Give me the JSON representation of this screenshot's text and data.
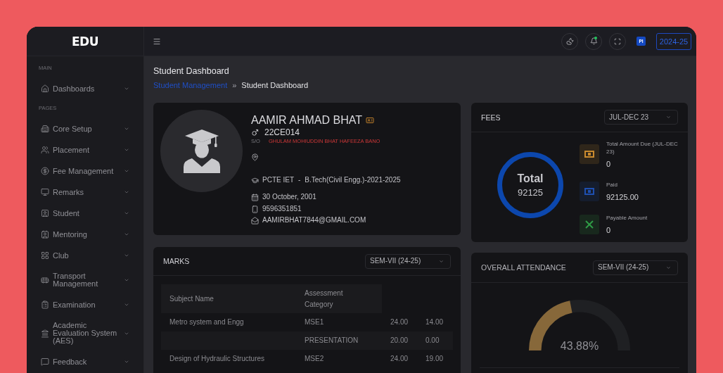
{
  "sidebar": {
    "logo": "EDU",
    "sections": [
      {
        "label": "MAIN",
        "items": [
          {
            "label": "Dashboards",
            "expanded": false
          }
        ]
      },
      {
        "label": "PAGES",
        "items": [
          {
            "label": "Core Setup",
            "expanded": false
          },
          {
            "label": "Placement",
            "expanded": false
          },
          {
            "label": "Fee Management",
            "expanded": false
          },
          {
            "label": "Remarks",
            "expanded": false
          },
          {
            "label": "Student",
            "expanded": false
          },
          {
            "label": "Mentoring",
            "expanded": false
          },
          {
            "label": "Club",
            "expanded": false
          },
          {
            "label": "Transport Management",
            "expanded": false
          },
          {
            "label": "Examination",
            "expanded": false
          },
          {
            "label": "Academic Evaluation System (AES)",
            "expanded": false
          },
          {
            "label": "Feedback",
            "expanded": false
          }
        ]
      }
    ]
  },
  "header": {
    "unread_notifications": true,
    "profile_initials": "PI",
    "session": "2024-25"
  },
  "page": {
    "title": "Student Dashboard",
    "breadcrumb": [
      {
        "label": "Student Management",
        "current": false
      },
      {
        "label": "Student Dashboard",
        "current": true
      }
    ],
    "breadcrumb_separator": "»"
  },
  "profile": {
    "name": "AAMIR AHMAD BHAT",
    "roll_no": "22CE014",
    "parent_label": "S/O",
    "parents": "GHULAM MOHIUDDIN BHAT HAFEEZA BANO",
    "institution": "PCTE IET",
    "separator": "-",
    "course": "B.Tech(Civil Engg.)-2021-2025",
    "dob": "30 October, 2001",
    "phone": "9596351851",
    "email": "AAMIRBHAT7844@GMAIL.COM"
  },
  "fees": {
    "title": "FEES",
    "period": "JUL-DEC 23",
    "total_label": "Total",
    "total_value": "92125",
    "items": [
      {
        "label": "Total Amount Due (JUL-DEC 23)",
        "value": "0",
        "color": "#c98a2e"
      },
      {
        "label": "Paid",
        "value": "92125.00",
        "color": "#1e4fb0"
      },
      {
        "label": "Payable Amount",
        "value": "0",
        "color": "#2f9c46"
      }
    ]
  },
  "marks": {
    "title": "MARKS",
    "semester": "SEM-VII (24-25)",
    "columns": [
      "Subject Name",
      "Assessment Category"
    ],
    "rows": [
      {
        "subject": "Metro system and Engg",
        "category": "MSE1",
        "column_3": "24.00",
        "column_4": "14.00"
      },
      {
        "category": "PRESENTATION",
        "column_3": "20.00",
        "column_4": "0.00"
      },
      {
        "subject": "Design of Hydraulic Structures",
        "category": "MSE2",
        "column_3": "24.00",
        "column_4": "19.00"
      }
    ]
  },
  "attendance": {
    "title": "OVERALL ATTENDANCE",
    "semester": "SEM-VII (24-25)",
    "level": 0.4388,
    "reading": "43.88%"
  }
}
